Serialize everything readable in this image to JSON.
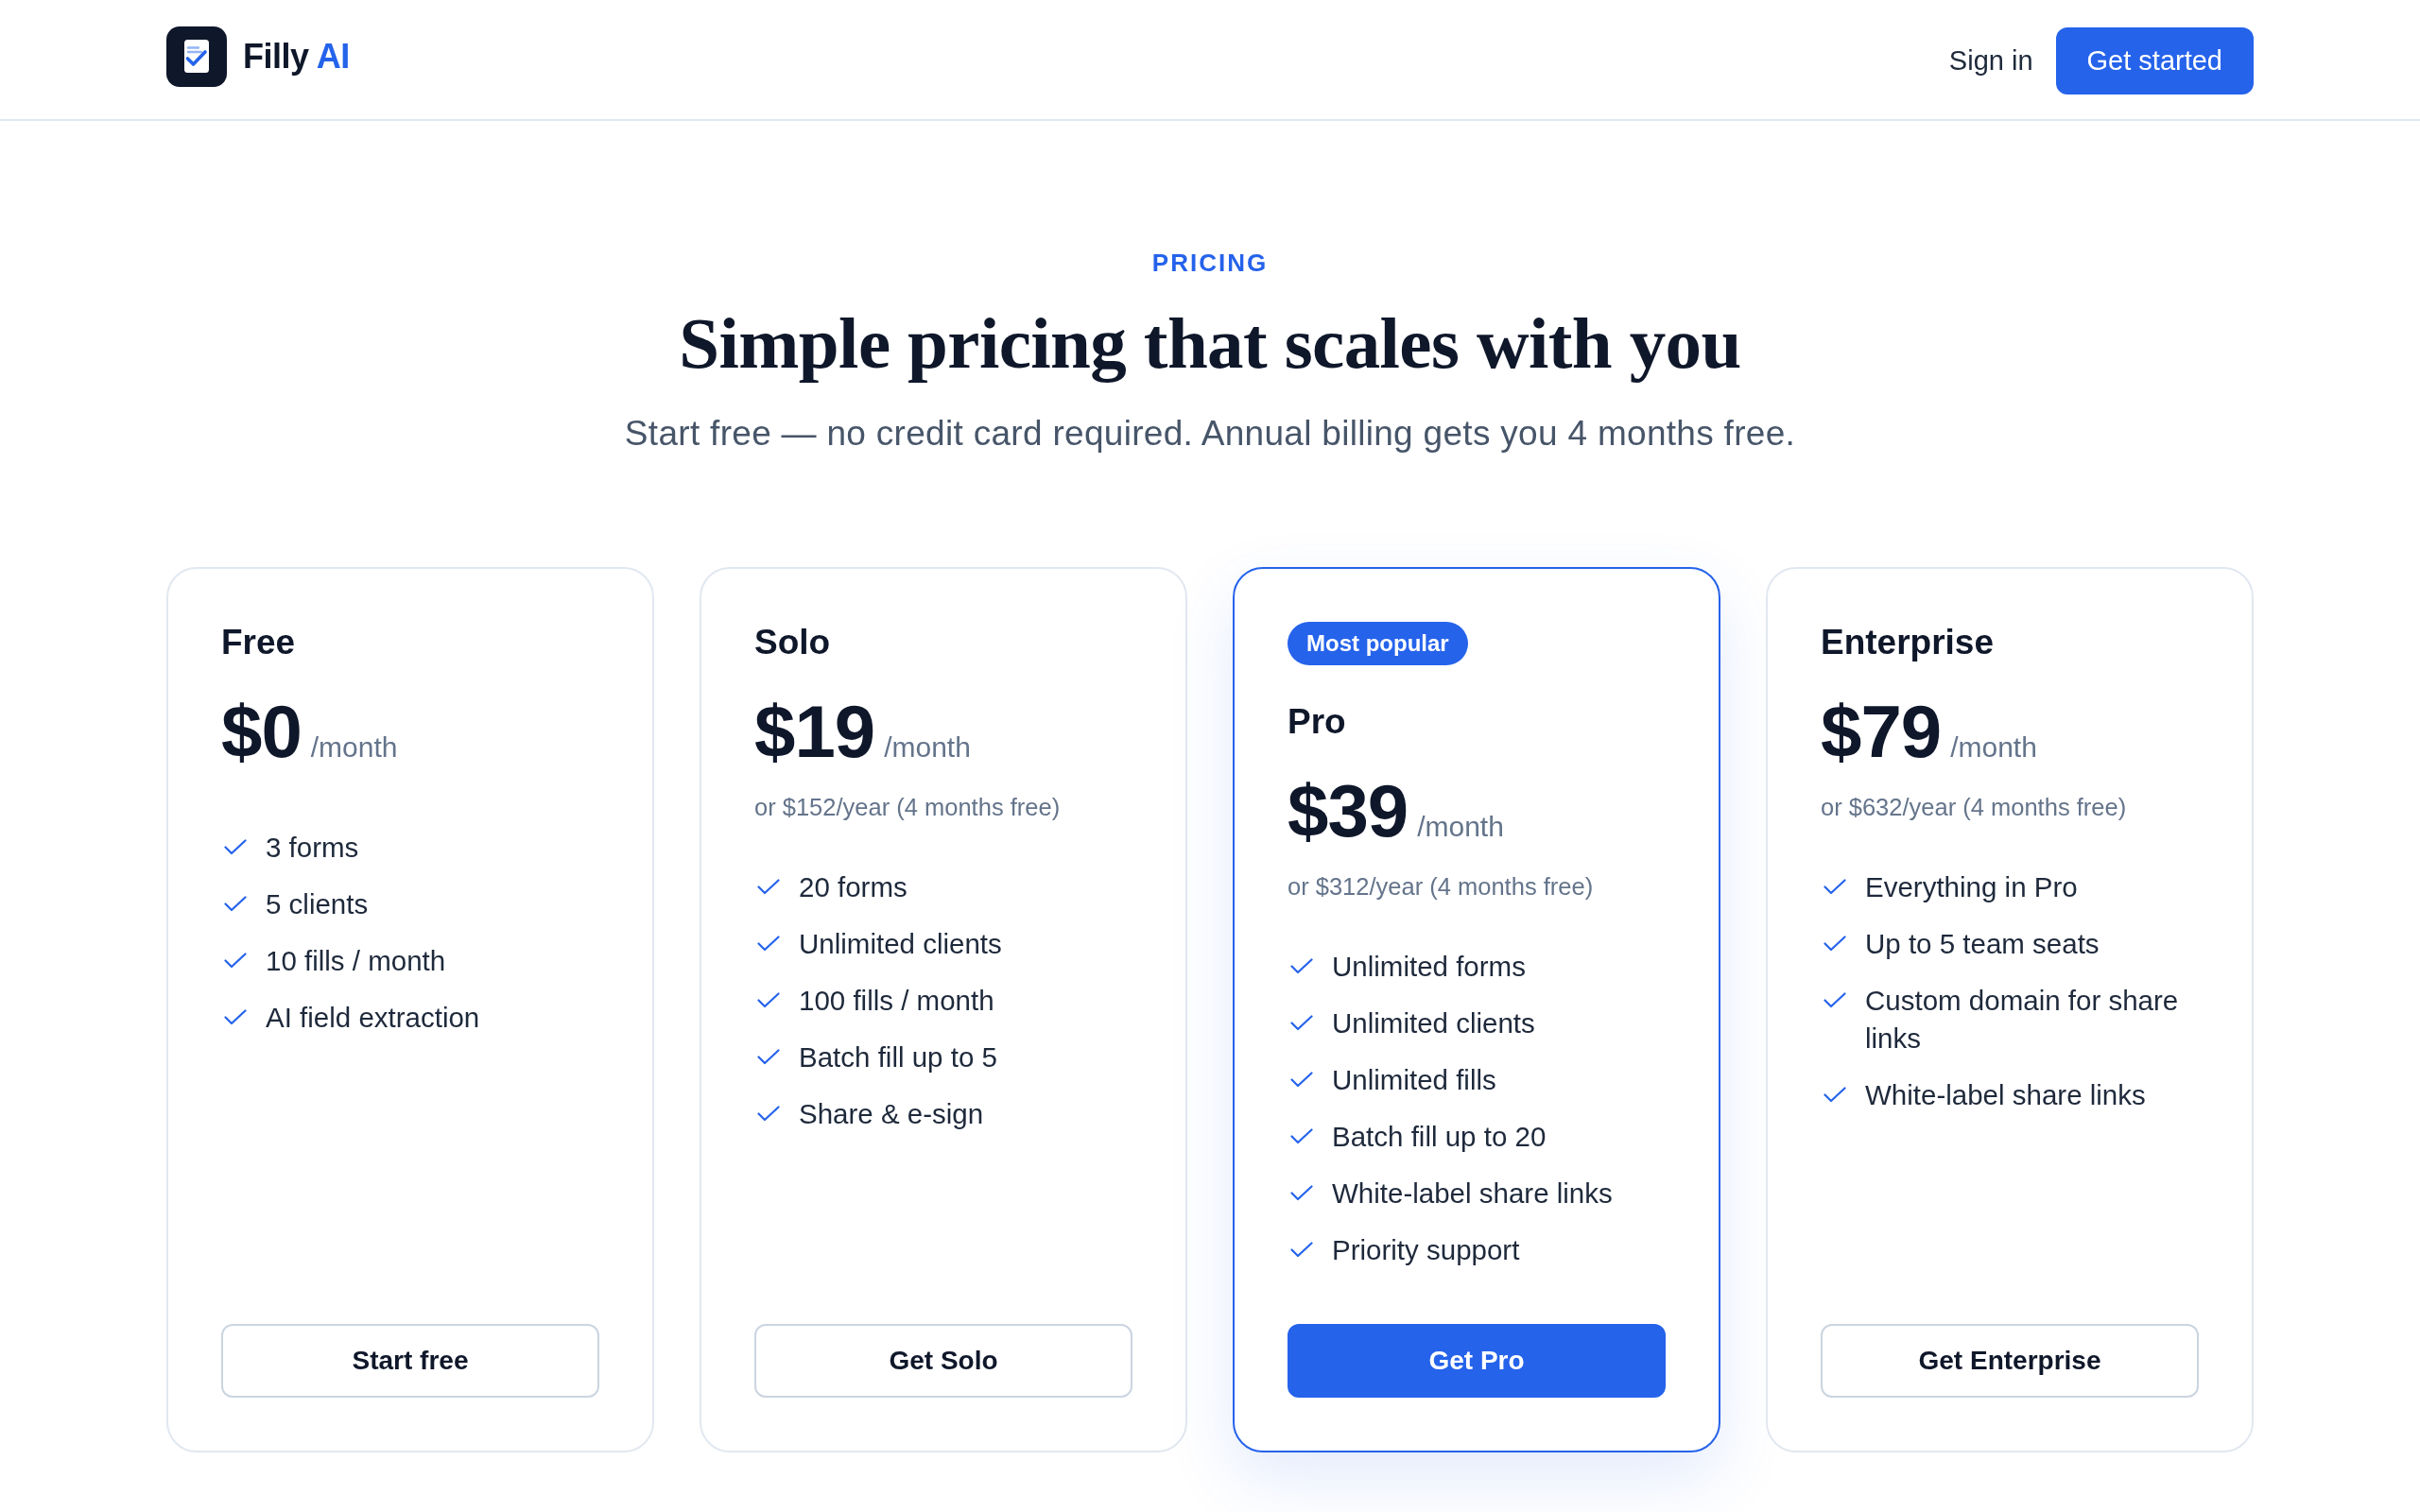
{
  "header": {
    "brand": {
      "name": "Filly",
      "accent": "AI"
    },
    "nav": [
      {
        "label": "Sign in",
        "kind": "link"
      },
      {
        "label": "Get started",
        "kind": "primary"
      }
    ]
  },
  "hero": {
    "eyebrow": "PRICING",
    "title": "Simple pricing that scales with you",
    "subtitle": "Start free — no credit card required. Annual billing gets you 4 months free."
  },
  "plans": [
    {
      "name": "Free",
      "featured": false,
      "price": "$0",
      "period": "/month",
      "features": [
        "3 forms",
        "5 clients",
        "10 fills / month",
        "AI field extraction"
      ],
      "cta": "Start free"
    },
    {
      "name": "Solo",
      "featured": false,
      "price": "$19",
      "period": "/month",
      "annual": "or $152/year (4 months free)",
      "features": [
        "20 forms",
        "Unlimited clients",
        "100 fills / month",
        "Batch fill up to 5",
        "Share & e-sign"
      ],
      "cta": "Get Solo"
    },
    {
      "name": "Pro",
      "featured": true,
      "badge": "Most popular",
      "price": "$39",
      "period": "/month",
      "annual": "or $312/year (4 months free)",
      "features": [
        "Unlimited forms",
        "Unlimited clients",
        "Unlimited fills",
        "Batch fill up to 20",
        "White-label share links",
        "Priority support"
      ],
      "cta": "Get Pro"
    },
    {
      "name": "Enterprise",
      "featured": false,
      "price": "$79",
      "period": "/month",
      "annual": "or $632/year (4 months free)",
      "features": [
        "Everything in Pro",
        "Up to 5 team seats",
        "Custom domain for share links",
        "White-label share links"
      ],
      "cta": "Get Enterprise"
    }
  ]
}
